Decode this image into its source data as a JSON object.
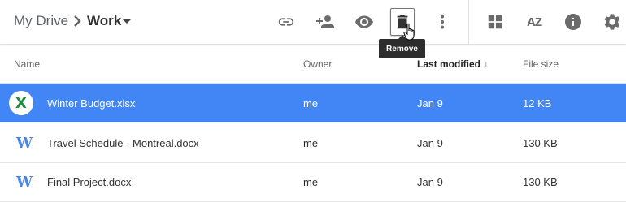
{
  "breadcrumb": {
    "root": "My Drive",
    "separator_icon": "chevron-right-icon",
    "current": "Work"
  },
  "toolbar": {
    "actions": [
      {
        "name": "get-link",
        "icon": "link-icon"
      },
      {
        "name": "share",
        "icon": "add-person-icon"
      },
      {
        "name": "preview",
        "icon": "eye-icon"
      },
      {
        "name": "remove",
        "icon": "trash-icon",
        "active": true
      },
      {
        "name": "more",
        "icon": "more-vertical-icon"
      }
    ],
    "view_actions": [
      {
        "name": "grid-view",
        "icon": "grid-icon"
      },
      {
        "name": "sort",
        "icon": "sort-az-icon",
        "label": "AZ"
      },
      {
        "name": "details",
        "icon": "info-icon"
      },
      {
        "name": "settings",
        "icon": "gear-icon"
      }
    ],
    "tooltip": "Remove"
  },
  "table": {
    "columns": {
      "name": "Name",
      "owner": "Owner",
      "last_modified": "Last modified",
      "file_size": "File size"
    },
    "sort_arrow": "↓",
    "rows": [
      {
        "icon": "excel-icon",
        "icon_glyph": "X",
        "name": "Winter Budget.xlsx",
        "owner": "me",
        "modified": "Jan 9",
        "size": "12 KB",
        "selected": true
      },
      {
        "icon": "word-icon",
        "icon_glyph": "W",
        "name": "Travel Schedule - Montreal.docx",
        "owner": "me",
        "modified": "Jan 9",
        "size": "130 KB",
        "selected": false
      },
      {
        "icon": "word-icon",
        "icon_glyph": "W",
        "name": "Final Project.docx",
        "owner": "me",
        "modified": "Jan 9",
        "size": "130 KB",
        "selected": false
      }
    ]
  },
  "colors": {
    "selection": "#4285f4",
    "excel_green": "#1e8e3e",
    "word_blue": "#4a86e8",
    "icon_gray": "#6b6b6b"
  }
}
